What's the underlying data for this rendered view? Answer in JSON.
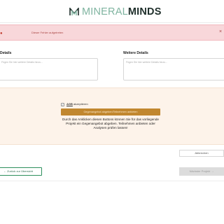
{
  "header": {
    "logo_icon": "mineral-minds-logo-icon",
    "brand_part1": "MINERAL",
    "brand_part2": "MINDS"
  },
  "alert": {
    "message": "Dieser Fehler aufgetreten",
    "icon": "alert-dot-icon",
    "close_icon": "close-icon",
    "close_symbol": "×"
  },
  "details_left": {
    "label": "Details",
    "placeholder": "Fügen Sie hier weitere Details hinzu..."
  },
  "details_right": {
    "label": "Weitere Details",
    "placeholder": "Fügen Sie hier weitere Details hinzu..."
  },
  "offer": {
    "agb_link": "AGB",
    "agb_suffix": " akzeptieren",
    "agb_checked": true,
    "submit_label": "Gegenangebot abgeben/Teilnehmen anbieten",
    "info_text": "Durch das Anklicken diesen Buttons können Sie für das vorliegende Projekt ein Gegenangebot abgeben. Teilnehmen anbieten oder Analysen prüfen lassen!"
  },
  "actions": {
    "secondary_label": "Abbrechen",
    "back_label": "← Zurück zur Übersicht",
    "next_label": "Nächster Projekt →"
  },
  "colors": {
    "brand_light": "#7fb4a0",
    "brand_dark": "#1f2f2b",
    "alert_bg": "#f8d7da",
    "offer_bg": "#fdf3ea",
    "offer_button": "#c1872f",
    "back_border": "#2d8f5c"
  }
}
